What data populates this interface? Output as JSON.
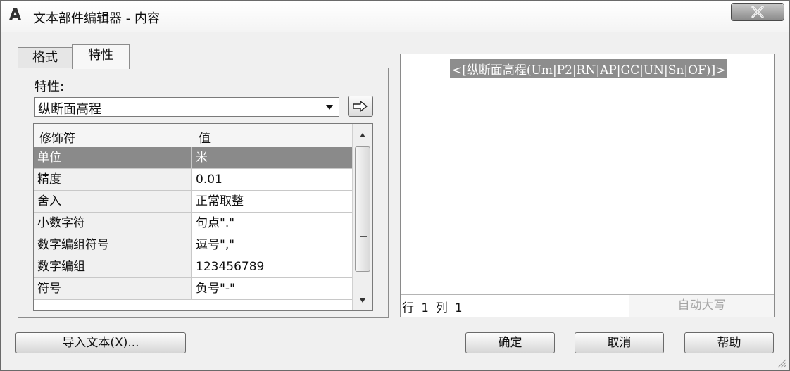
{
  "window": {
    "title": "文本部件编辑器 - 内容",
    "logo": "A",
    "close_icon": "close-x-icon"
  },
  "tabs": [
    {
      "label": "格式",
      "active": false
    },
    {
      "label": "特性",
      "active": true
    }
  ],
  "properties": {
    "label": "特性:",
    "selected_property": "纵断面高程",
    "insert_icon": "arrow-right-icon",
    "grid": {
      "headers": [
        "修饰符",
        "值"
      ],
      "rows": [
        {
          "modifier": "单位",
          "value": "米",
          "selected": true
        },
        {
          "modifier": "精度",
          "value": "0.01"
        },
        {
          "modifier": "舍入",
          "value": "正常取整"
        },
        {
          "modifier": "小数字符",
          "value": "句点\".\""
        },
        {
          "modifier": "数字编组符号",
          "value": "逗号\",\""
        },
        {
          "modifier": "数字编组",
          "value": "123456789"
        },
        {
          "modifier": "符号",
          "value": "负号\"-\""
        }
      ]
    }
  },
  "editor": {
    "content": "<[纵断面高程(Um|P2|RN|AP|GC|UN|Sn|OF)]>",
    "status_position": "行 1 列 1",
    "status_caps": "自动大写"
  },
  "buttons": {
    "import_text": "导入文本(X)...",
    "ok": "确定",
    "cancel": "取消",
    "help": "帮助"
  },
  "colors": {
    "selection": "#8a8a8a",
    "window_bg": "#f0f0f0"
  }
}
